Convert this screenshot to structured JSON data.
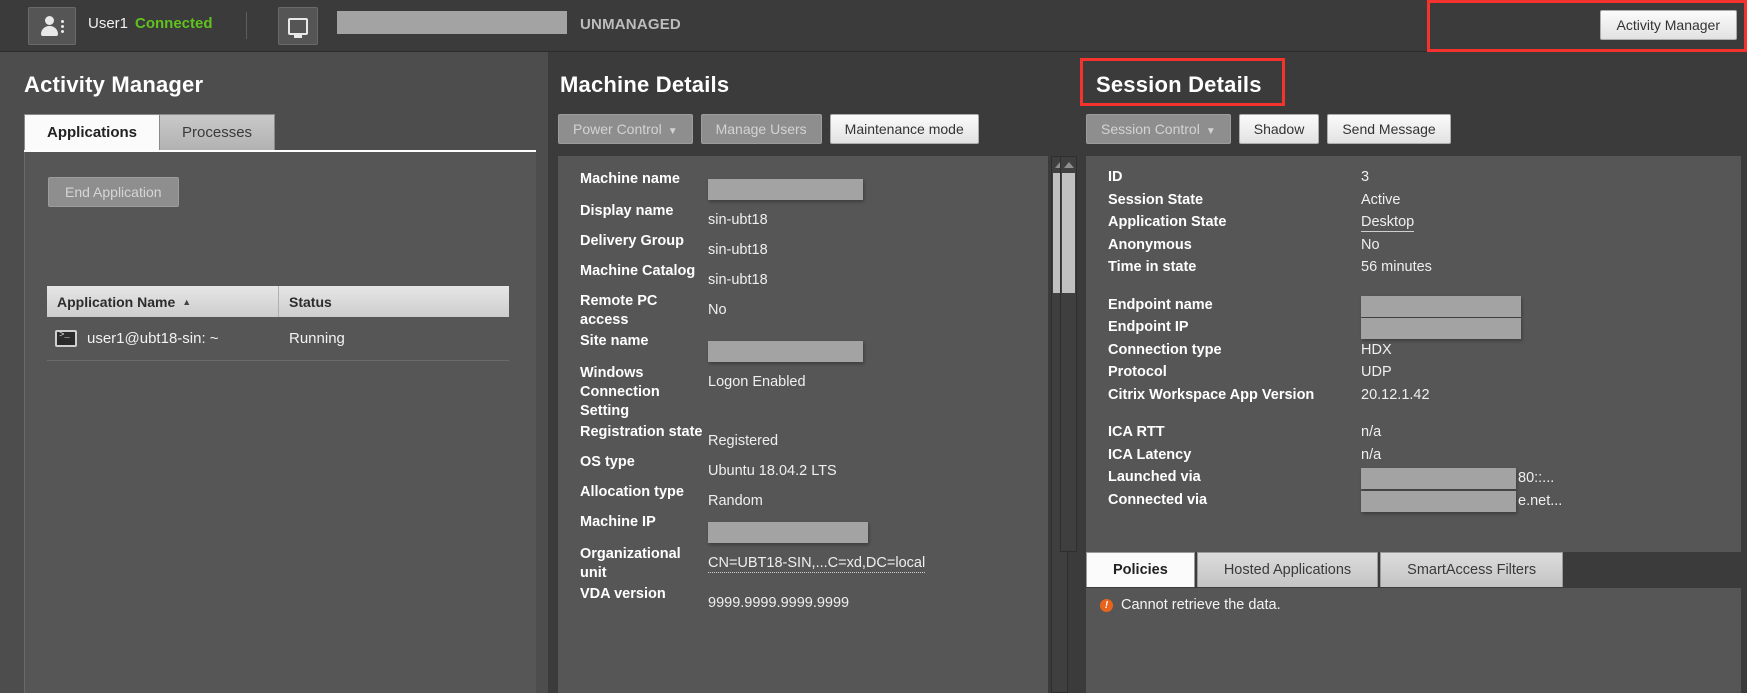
{
  "topbar": {
    "user_icon": "user-card-icon",
    "user_name": "User1",
    "status": "Connected",
    "machine_icon": "monitor-icon",
    "machine_name_redacted": "",
    "unmanaged_label": "UNMANAGED",
    "activity_manager_button": "Activity Manager",
    "highlight_color": "#f5332e",
    "status_color": "#60c21f"
  },
  "activity_manager": {
    "title": "Activity Manager",
    "tabs": [
      {
        "label": "Applications",
        "active": true
      },
      {
        "label": "Processes",
        "active": false
      }
    ],
    "end_application_button": "End Application",
    "table": {
      "columns": [
        "Application Name",
        "Status"
      ],
      "sort_column": "Application Name",
      "sort_direction": "ascending",
      "sort_caret": "▲",
      "rows": [
        {
          "icon": "terminal-icon",
          "name": "user1@ubt18-sin: ~",
          "status": "Running"
        }
      ]
    }
  },
  "machine_details": {
    "title": "Machine Details",
    "buttons": [
      {
        "label": "Power Control",
        "has_caret": true,
        "style": "dim"
      },
      {
        "label": "Manage Users",
        "has_caret": false,
        "style": "dim"
      },
      {
        "label": "Maintenance mode",
        "has_caret": false,
        "style": "light"
      }
    ],
    "rows": [
      {
        "label": "Machine name",
        "value": "",
        "redacted": true,
        "redact_width": 155
      },
      {
        "label": "Display name",
        "value": "sin-ubt18",
        "redacted": false
      },
      {
        "label": "Delivery Group",
        "value": "sin-ubt18",
        "redacted": false
      },
      {
        "label": "Machine Catalog",
        "value": "sin-ubt18",
        "redacted": false
      },
      {
        "label": "Remote PC access",
        "value": "No",
        "redacted": false
      },
      {
        "label": "Site name",
        "value": "",
        "redacted": true,
        "redact_width": 155
      },
      {
        "label": "Windows Connection Setting",
        "value": "Logon Enabled",
        "redacted": false
      },
      {
        "label": "Registration state",
        "value": "Registered",
        "redacted": false
      },
      {
        "label": "OS type",
        "value": "Ubuntu 18.04.2 LTS",
        "redacted": false
      },
      {
        "label": "Allocation type",
        "value": "Random",
        "redacted": false
      },
      {
        "label": "Machine IP",
        "value": "",
        "redacted": true,
        "redact_width": 160
      },
      {
        "label": "Organizational unit",
        "value": "CN=UBT18-SIN,...C=xd,DC=local",
        "redacted": false,
        "underline": "dotted"
      },
      {
        "label": "VDA version",
        "value": "9999.9999.9999.9999",
        "redacted": false
      }
    ],
    "scrollbar": "vertical-scrollbar"
  },
  "session_details": {
    "title": "Session Details",
    "highlighted": true,
    "buttons": [
      {
        "label": "Session Control",
        "has_caret": true,
        "style": "dim"
      },
      {
        "label": "Shadow",
        "has_caret": false,
        "style": "light"
      },
      {
        "label": "Send Message",
        "has_caret": false,
        "style": "light"
      }
    ],
    "rows": [
      {
        "label": "ID",
        "value": "3",
        "redacted": false
      },
      {
        "label": "Session State",
        "value": "Active",
        "redacted": false
      },
      {
        "label": "Application State",
        "value": "Desktop",
        "redacted": false,
        "underline": "plain"
      },
      {
        "label": "Anonymous",
        "value": "No",
        "redacted": false
      },
      {
        "label": "Time in state",
        "value": "56 minutes",
        "redacted": false
      },
      {
        "spacer": true
      },
      {
        "label": "Endpoint name",
        "value": "",
        "redacted": true,
        "redact_width": 160
      },
      {
        "label": "Endpoint IP",
        "value": "",
        "redacted": true,
        "redact_width": 160
      },
      {
        "label": "Connection type",
        "value": "HDX",
        "redacted": false
      },
      {
        "label": "Protocol",
        "value": "UDP",
        "redacted": false
      },
      {
        "label": "Citrix Workspace App Version",
        "value": "20.12.1.42",
        "redacted": false
      },
      {
        "spacer": true
      },
      {
        "label": "ICA RTT",
        "value": "n/a",
        "redacted": false
      },
      {
        "label": "ICA Latency",
        "value": "n/a",
        "redacted": false
      },
      {
        "label": "Launched via",
        "value": "",
        "redacted": true,
        "redact_width": 155,
        "overflow_text": "80::...",
        "underline": "dotted"
      },
      {
        "label": "Connected via",
        "value": "",
        "redacted": true,
        "redact_width": 155,
        "overflow_text": "e.net...",
        "underline": "dotted"
      }
    ],
    "tabs": [
      {
        "label": "Policies",
        "active": true
      },
      {
        "label": "Hosted Applications",
        "active": false
      },
      {
        "label": "SmartAccess Filters",
        "active": false
      }
    ],
    "tab_content": {
      "error_icon": "error-icon",
      "error_message": "Cannot retrieve the data."
    },
    "scrollbar": "vertical-scrollbar"
  }
}
